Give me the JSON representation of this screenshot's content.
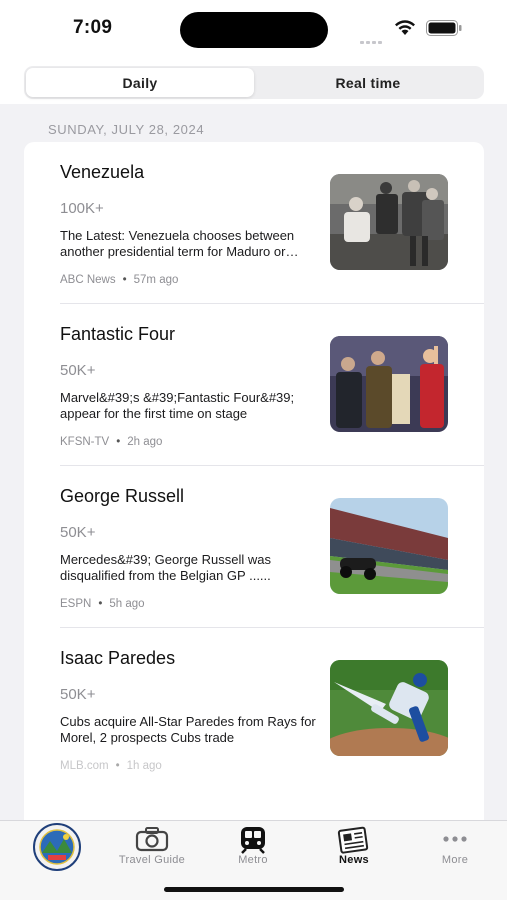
{
  "status_bar": {
    "time": "7:09"
  },
  "segments": [
    {
      "label": "Daily",
      "active": true
    },
    {
      "label": "Real time",
      "active": false
    }
  ],
  "date_header": "SUNDAY, JULY 28, 2024",
  "news": [
    {
      "title": "Venezuela",
      "count": "100K+",
      "snippet": "The Latest: Venezuela chooses between another presidential term for Maduro or change",
      "source": "ABC News",
      "time": "57m ago"
    },
    {
      "title": "Fantastic Four",
      "count": "50K+",
      "snippet": "Marvel&#39;s &#39;Fantastic Four&#39; appear for the first time on stage",
      "source": "KFSN-TV",
      "time": "2h ago"
    },
    {
      "title": "George Russell",
      "count": "50K+",
      "snippet": "Mercedes&#39; George Russell was disqualified from the Belgian GP ......",
      "source": "ESPN",
      "time": "5h ago"
    },
    {
      "title": "Isaac Paredes",
      "count": "50K+",
      "snippet": "Cubs acquire All-Star Paredes from Rays for Morel, 2 prospects Cubs trade",
      "source": "MLB.com",
      "time": "1h ago"
    }
  ],
  "tab_bar": {
    "items": [
      {
        "label": "",
        "icon": "city-seal-icon"
      },
      {
        "label": "Travel Guide",
        "icon": "camera-icon"
      },
      {
        "label": "Metro",
        "icon": "train-icon"
      },
      {
        "label": "News",
        "icon": "newspaper-icon",
        "active": true
      },
      {
        "label": "More",
        "icon": "more-dots-icon"
      }
    ]
  }
}
